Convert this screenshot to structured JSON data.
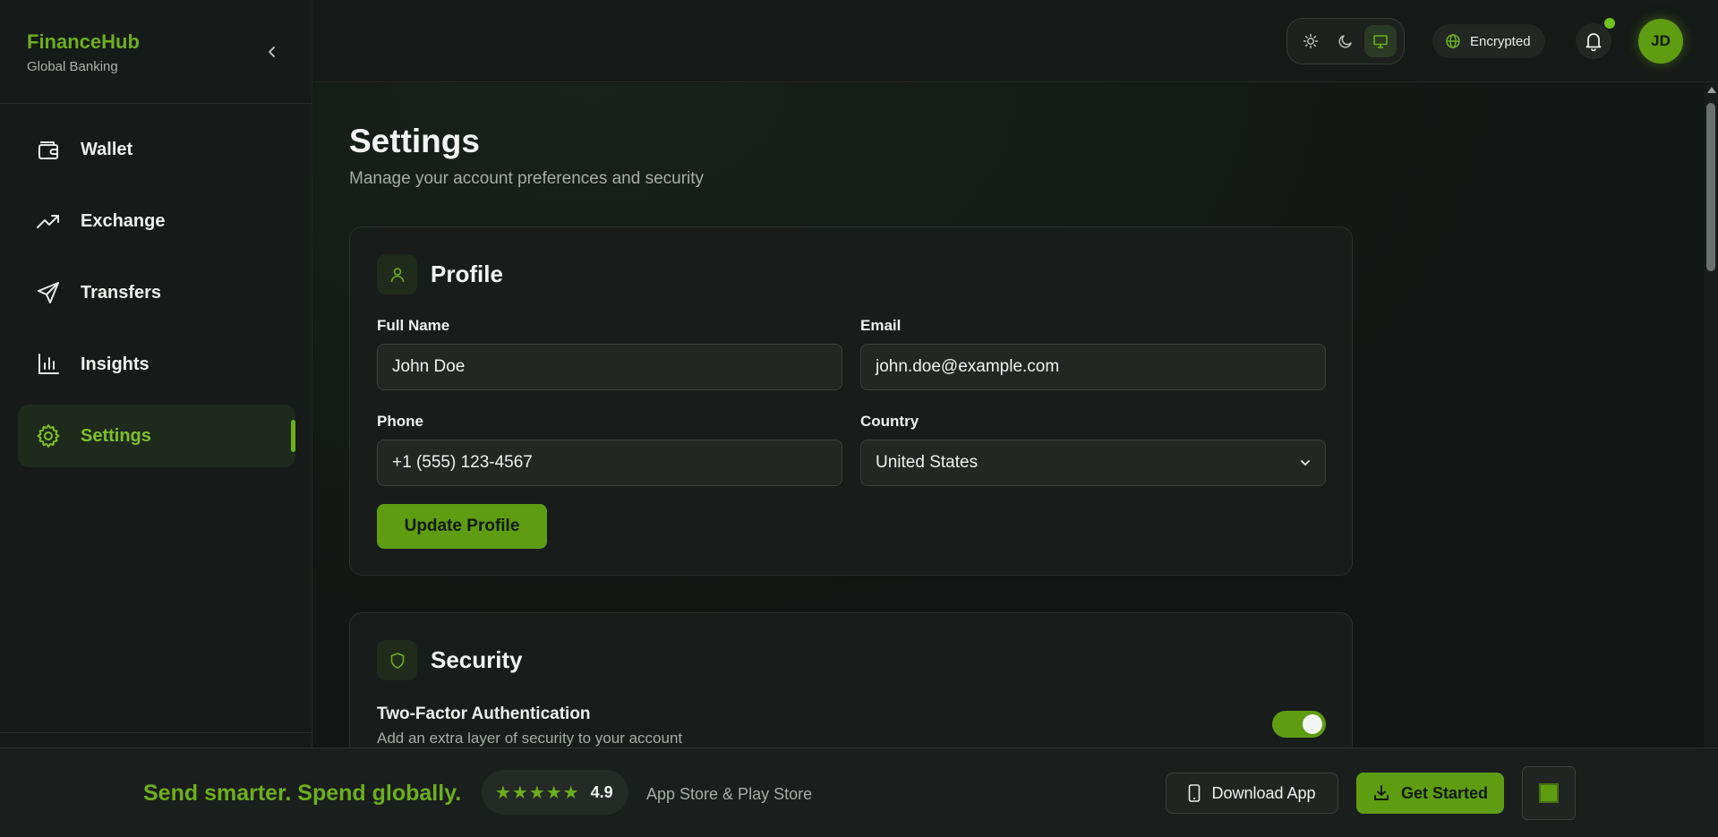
{
  "brand": {
    "name": "FinanceHub",
    "subtitle": "Global Banking"
  },
  "sidebar": {
    "items": [
      {
        "label": "Wallet",
        "icon": "wallet-icon"
      },
      {
        "label": "Exchange",
        "icon": "trending-up-icon"
      },
      {
        "label": "Transfers",
        "icon": "send-icon"
      },
      {
        "label": "Insights",
        "icon": "bar-chart-icon"
      },
      {
        "label": "Settings",
        "icon": "gear-icon",
        "active": true
      }
    ]
  },
  "header": {
    "theme_options": [
      "light",
      "dark",
      "system"
    ],
    "theme_selected": "system",
    "encrypted_label": "Encrypted",
    "avatar_initials": "JD"
  },
  "page": {
    "title": "Settings",
    "subtitle": "Manage your account preferences and security"
  },
  "profile": {
    "title": "Profile",
    "full_name_label": "Full Name",
    "full_name_value": "John Doe",
    "email_label": "Email",
    "email_value": "john.doe@example.com",
    "phone_label": "Phone",
    "phone_value": "+1 (555) 123-4567",
    "country_label": "Country",
    "country_value": "United States",
    "update_button": "Update Profile"
  },
  "security": {
    "title": "Security",
    "twofa_title": "Two-Factor Authentication",
    "twofa_desc": "Add an extra layer of security to your account",
    "twofa_enabled": true
  },
  "banner": {
    "tagline": "Send smarter. Spend globally.",
    "stars": "★★★★★",
    "rating": "4.9",
    "stores": "App Store & Play Store",
    "download_label": "Download App",
    "get_started_label": "Get Started"
  },
  "colors": {
    "accent": "#6dae1c",
    "accent_button": "#5e9c12",
    "background": "#121614"
  }
}
